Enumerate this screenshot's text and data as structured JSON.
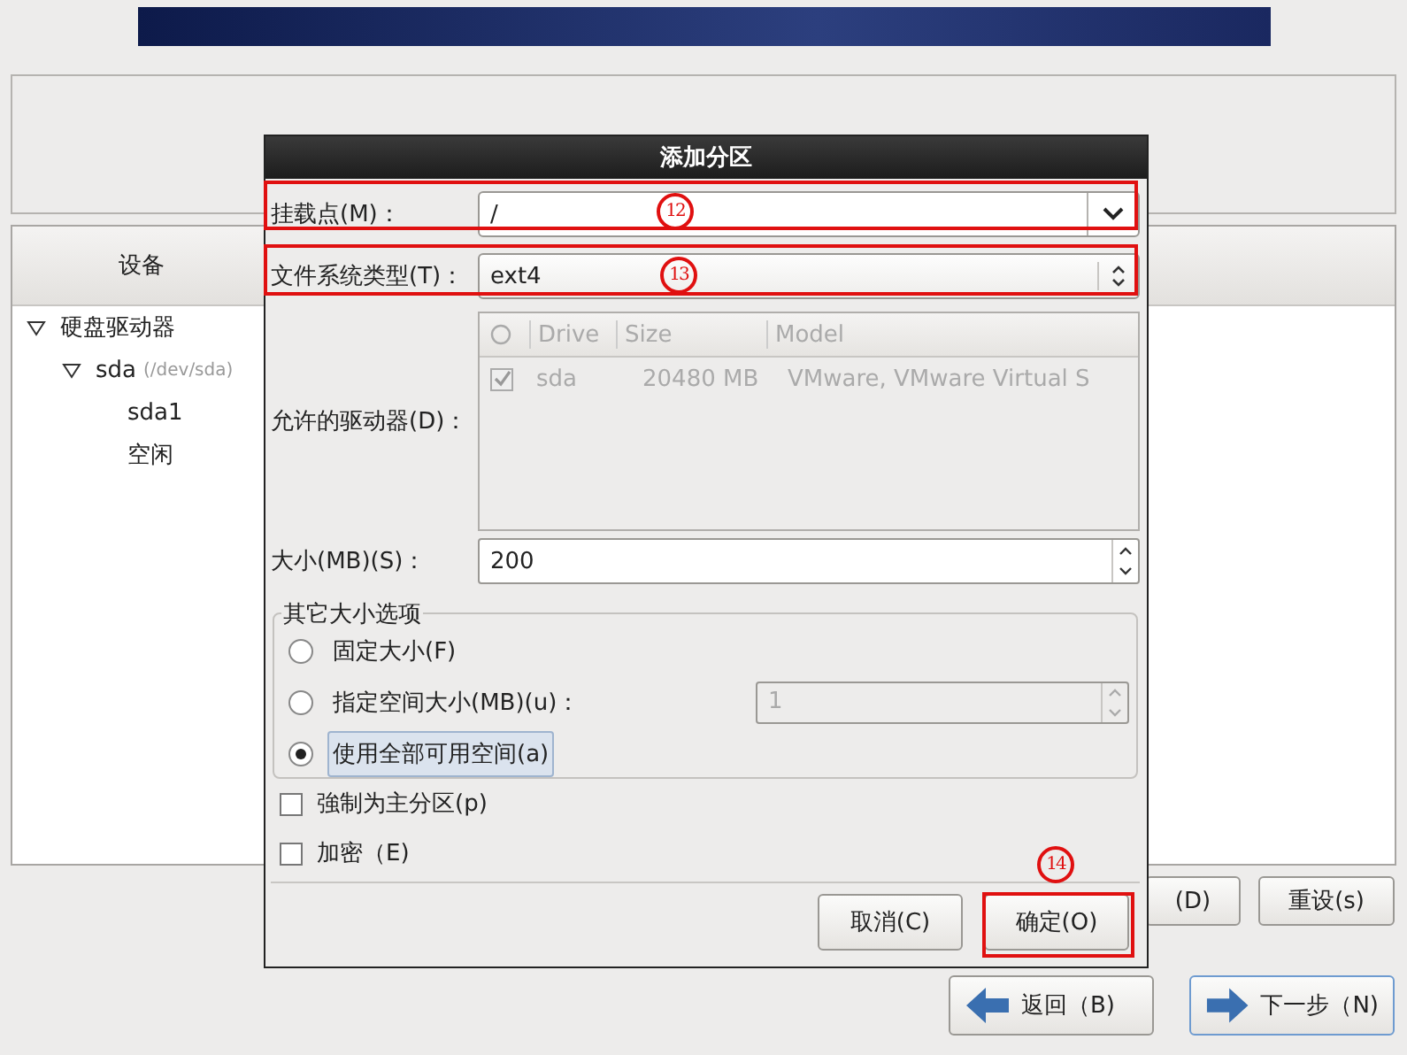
{
  "background": {
    "tree_header": "设备",
    "tree": [
      {
        "label": "硬盘驱动器",
        "expanded": true,
        "children": [
          {
            "label": "sda",
            "note": "(/dev/sda)",
            "expanded": true,
            "children": [
              {
                "label": "sda1"
              },
              {
                "label": "空闲"
              }
            ]
          }
        ]
      }
    ],
    "buttons": [
      {
        "label": "(D)"
      },
      {
        "label": "重设(s)"
      }
    ],
    "nav_buttons": [
      {
        "label": "返回（B)",
        "kind": "back"
      },
      {
        "label": "下一步（N)",
        "kind": "next"
      }
    ]
  },
  "dialog": {
    "title": "添加分区",
    "mount_point": {
      "label": "挂载点(M)：",
      "value": "/"
    },
    "fs_type": {
      "label": "文件系统类型(T)：",
      "value": "ext4"
    },
    "drives": {
      "label": "允许的驱动器(D)：",
      "columns": [
        "Drive",
        "Size",
        "Model"
      ],
      "rows": [
        {
          "checked": true,
          "drive": "sda",
          "size": "20480 MB",
          "model": "VMware, VMware Virtual S"
        }
      ]
    },
    "size": {
      "label": "大小(MB)(S)：",
      "value": "200"
    },
    "size_options": {
      "title": "其它大小选项",
      "options": [
        {
          "label": "固定大小(F)",
          "selected": false,
          "kind": "plain"
        },
        {
          "label": "指定空间大小(MB)(u)：",
          "selected": false,
          "kind": "spin",
          "value": "1"
        },
        {
          "label": "使用全部可用空间(a)",
          "selected": true,
          "kind": "plain"
        }
      ]
    },
    "checks": [
      {
        "label": "強制为主分区(p)",
        "checked": false
      },
      {
        "label": "加密（E)",
        "checked": false
      }
    ],
    "buttons": [
      {
        "label": "取消(C)"
      },
      {
        "label": "确定(O)"
      }
    ]
  },
  "annotations": [
    {
      "label": "12"
    },
    {
      "label": "13"
    },
    {
      "label": "14"
    }
  ]
}
